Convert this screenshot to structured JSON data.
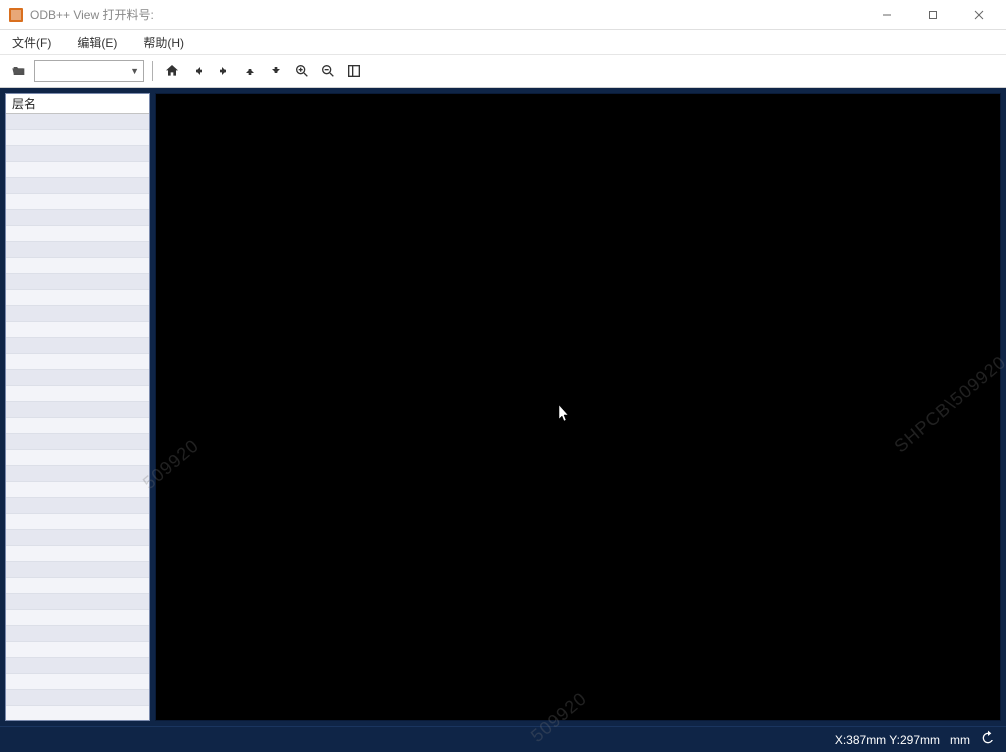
{
  "window": {
    "title": "ODB++ View 打开料号:"
  },
  "menu": {
    "file": "文件(F)",
    "edit": "编辑(E)",
    "help": "帮助(H)"
  },
  "toolbar": {
    "combo_value": "",
    "icons": {
      "open": "folder-open-icon",
      "home": "home-icon",
      "back": "arrow-left-icon",
      "forward": "arrow-right-icon",
      "up": "arrow-up-icon",
      "down": "arrow-down-icon",
      "zoom_in": "zoom-in-icon",
      "zoom_out": "zoom-out-icon",
      "list": "list-panel-icon"
    }
  },
  "sidebar": {
    "header": "层名",
    "row_count": 38
  },
  "viewport": {
    "watermark1": "509920",
    "watermark2": "SHPCB\\509920",
    "watermark3": "509920"
  },
  "statusbar": {
    "coords": "X:387mm Y:297mm",
    "unit": "mm"
  }
}
